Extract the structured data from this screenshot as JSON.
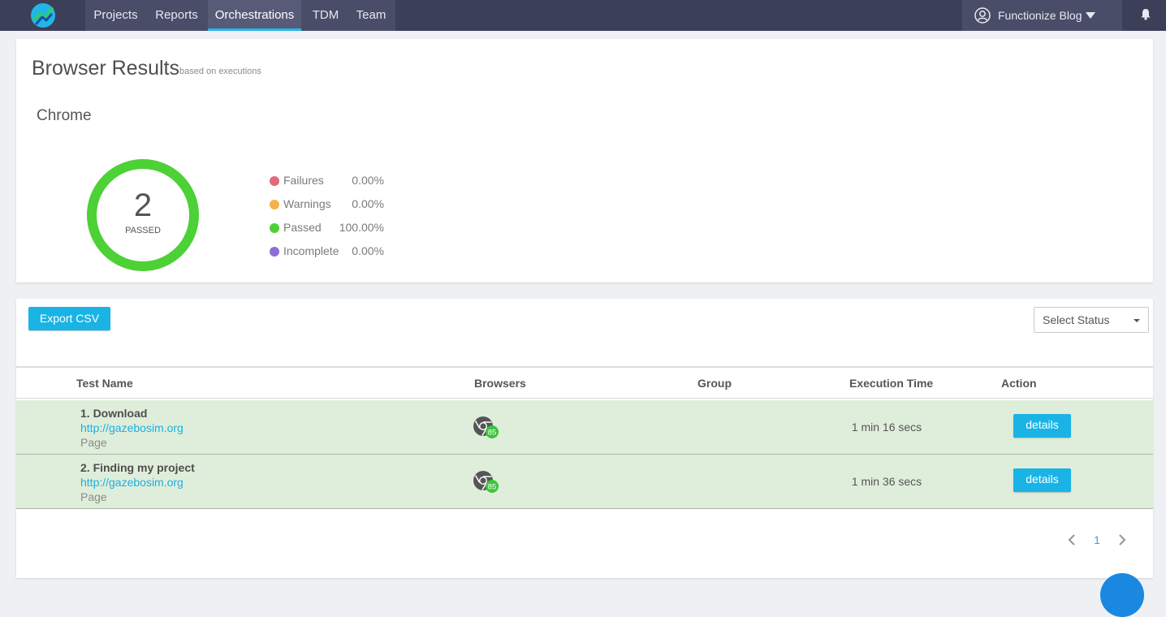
{
  "nav": {
    "items": [
      {
        "label": "Projects"
      },
      {
        "label": "Reports"
      },
      {
        "label": "Orchestrations",
        "active": true
      },
      {
        "label": "TDM"
      },
      {
        "label": "Team"
      }
    ],
    "user_name": "Functionize Blog",
    "icons": [
      "functionize-logo-icon",
      "user-circle-icon",
      "caret-down-icon",
      "bell-icon"
    ]
  },
  "results": {
    "title": "Browser Results",
    "subtitle": "based on executions",
    "browser": "Chrome",
    "donut": {
      "count": "2",
      "label": "PASSED",
      "passed_fraction": 1.0,
      "color": "#4cd137"
    },
    "legend": [
      {
        "label": "Failures",
        "value": "0.00%",
        "color": "#e06a78"
      },
      {
        "label": "Warnings",
        "value": "0.00%",
        "color": "#f5b24a"
      },
      {
        "label": "Passed",
        "value": "100.00%",
        "color": "#4cd137"
      },
      {
        "label": "Incomplete",
        "value": "0.00%",
        "color": "#8c6fd8"
      }
    ]
  },
  "table": {
    "export_label": "Export CSV",
    "status_placeholder": "Select Status",
    "headers": {
      "test_name": "Test Name",
      "browsers": "Browsers",
      "group": "Group",
      "execution_time": "Execution Time",
      "action": "Action"
    },
    "rows": [
      {
        "name": "1. Download",
        "url": "http://gazebosim.org",
        "type": "Page",
        "browser_version": "85",
        "group": "",
        "time": "1 min 16 secs",
        "action": "details"
      },
      {
        "name": "2. Finding my project",
        "url": "http://gazebosim.org",
        "type": "Page",
        "browser_version": "85",
        "group": "",
        "time": "1 min 36 secs",
        "action": "details"
      }
    ],
    "pagination": {
      "current_page": "1"
    }
  },
  "colors": {
    "topbar": "#3c3f58",
    "accent": "#1ab3e6",
    "row_pass_bg": "#dfeeda"
  }
}
